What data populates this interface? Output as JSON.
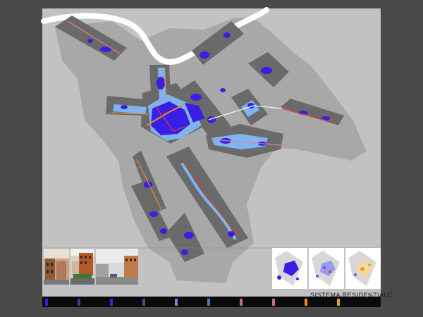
{
  "sheet": {
    "caption": "SISTEMA RESIDENZIALE"
  },
  "map": {
    "colors": {
      "background": "#4a4a4a",
      "sheet": "#c2c2c2",
      "city_area": "#a8a8a8",
      "district": "#6a6a6a",
      "river": "#ffffff",
      "residential_dense": "#3a1ee6",
      "residential_light": "#5a8ce8",
      "water_light": "#7fb4f0",
      "route_orange": "#f08a1e",
      "route_red": "#d9402a",
      "route_pink": "#e87a9a"
    }
  },
  "photos": [
    {
      "name": "street-photo-1",
      "palette": [
        "#8a6a4a",
        "#c9a27a",
        "#5a4a3a"
      ]
    },
    {
      "name": "street-photo-2",
      "palette": [
        "#b35a2a",
        "#d9d0c0",
        "#3a7a3a"
      ]
    },
    {
      "name": "street-photo-3",
      "palette": [
        "#8a8a8a",
        "#c07a4a",
        "#d9d9d9"
      ]
    }
  ],
  "thumbnails": [
    {
      "name": "thumb-residential-blue",
      "accent": "#3a1ee6"
    },
    {
      "name": "thumb-residential-mixed",
      "accent": "#5a5ae6"
    },
    {
      "name": "thumb-residential-orange",
      "accent": "#f0a020"
    }
  ],
  "legend": {
    "items": [
      {
        "color": "#3a1ee6"
      },
      {
        "color": "#5a2aa0"
      },
      {
        "color": "#2a2ad0"
      },
      {
        "color": "#4a4a9a"
      },
      {
        "color": "#6a8ae0"
      },
      {
        "color": "#4a7ac0"
      },
      {
        "color": "#c07a6a"
      },
      {
        "color": "#d06a7a"
      },
      {
        "color": "#f08a1e"
      },
      {
        "color": "#e0a040"
      }
    ]
  }
}
